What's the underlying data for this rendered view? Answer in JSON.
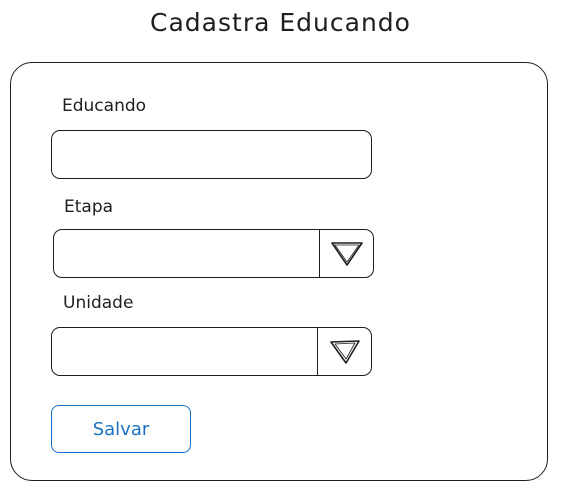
{
  "page": {
    "title": "Cadastra Educando"
  },
  "form": {
    "fields": [
      {
        "label": "Educando",
        "type": "text",
        "value": "",
        "placeholder": ""
      },
      {
        "label": "Etapa",
        "type": "select",
        "selected": ""
      },
      {
        "label": "Unidade",
        "type": "select",
        "selected": ""
      }
    ],
    "save_label": "Salvar"
  },
  "icons": {
    "select_arrow": "triangle-down-icon"
  },
  "colors": {
    "stroke": "#1e1e1e",
    "accent": "#1971c2",
    "background": "#ffffff"
  }
}
